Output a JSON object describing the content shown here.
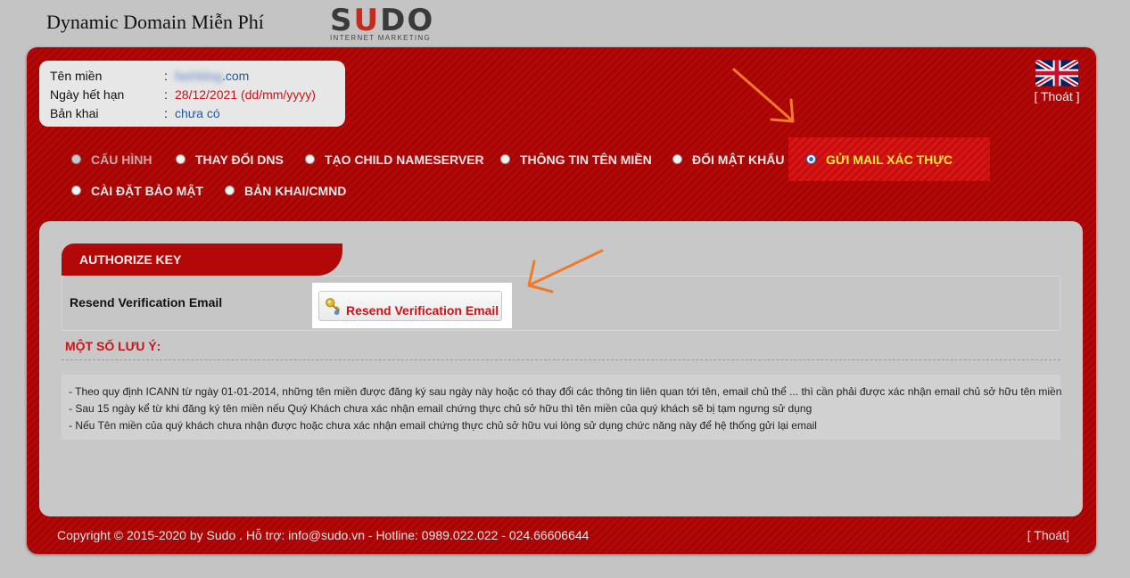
{
  "header": {
    "title": "Dynamic Domain Miễn Phí",
    "logo_text": "SUDO",
    "logo_tagline": "INTERNET MARKETING"
  },
  "domain_info": {
    "domain_label": "Tên miền",
    "domain_value_blurred": "fashblog",
    "domain_value_suffix": ".com",
    "expiry_label": "Ngày hết hạn",
    "expiry_value": "28/12/2021 (dd/mm/yyyy)",
    "declaration_label": "Bản khai",
    "declaration_value": "chưa có",
    "separator": ":"
  },
  "language": {
    "flag_icon": "uk-flag-icon",
    "logout": "[ Thoát ]"
  },
  "nav": {
    "items": [
      {
        "label": "CẤU HÌNH",
        "state": "disabled"
      },
      {
        "label": "THAY ĐỔI DNS",
        "state": "unchecked"
      },
      {
        "label": "TẠO CHILD NAMESERVER",
        "state": "unchecked"
      },
      {
        "label": "THÔNG TIN TÊN MIỀN",
        "state": "unchecked"
      },
      {
        "label": "ĐỔI MẬT KHẨU",
        "state": "unchecked"
      },
      {
        "label": "GỬI MAIL XÁC THỰC",
        "state": "checked"
      },
      {
        "label": "CÀI ĐẶT BẢO MẬT",
        "state": "unchecked"
      },
      {
        "label": "BẢN KHAI/CMND",
        "state": "unchecked"
      }
    ]
  },
  "authorize": {
    "header": "AUTHORIZE KEY",
    "row_label": "Resend Verification Email",
    "button_label": "Resend Verification Email",
    "button_icon": "key-icon"
  },
  "notes": {
    "title": "MỘT SỐ LƯU Ý:",
    "items": [
      "-  Theo quy định ICANN từ ngày 01-01-2014, những tên miền được đăng ký sau ngày này hoặc có thay đổi các thông tin liên quan tới tên, email chủ thể ... thì cần phải được xác nhận email chủ sở hữu tên miền",
      "-  Sau 15 ngày kể từ khi đăng ký tên miền nếu Quý Khách chưa xác nhận email chứng thực chủ sở hữu thì tên miền của quý khách sẽ bị tạm ngưng sử dụng",
      "-  Nếu Tên miền của quý khách chưa nhận được hoặc chưa xác nhận email chứng thực chủ sở hữu vui lòng sử dụng chức năng này để hệ thống gửi lại email"
    ]
  },
  "footer": {
    "copyright": "Copyright © 2015-2020 by Sudo . Hỗ trợ: info@sudo.vn - Hotline: 0989.022.022 - 024.66606644",
    "logout": "[ Thoát]"
  },
  "colors": {
    "brand_red": "#b30808",
    "active_tab": "#d91616",
    "active_text": "#ffee33",
    "annotation_arrow": "#f07a2a"
  }
}
